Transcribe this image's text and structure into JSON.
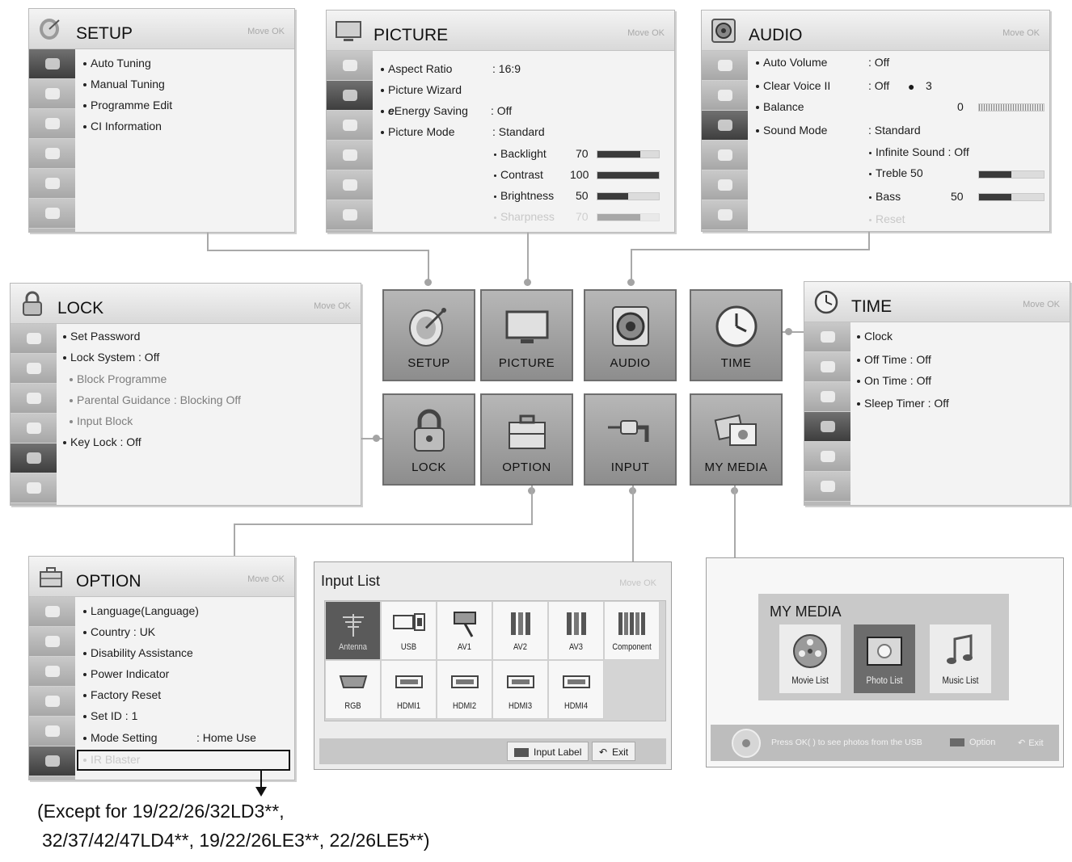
{
  "nav_hint": "Move  OK",
  "setup": {
    "title": "SETUP",
    "items": [
      "Auto Tuning",
      "Manual Tuning",
      "Programme Edit",
      "CI Information"
    ]
  },
  "picture": {
    "title": "PICTURE",
    "items": [
      {
        "label": "Aspect Ratio",
        "value": ": 16:9"
      },
      {
        "label": "Picture Wizard",
        "value": ""
      },
      {
        "label": "Energy Saving",
        "value": ": Off"
      },
      {
        "label": "Picture Mode",
        "value": ": Standard"
      }
    ],
    "sub": [
      {
        "label": "Backlight",
        "value": "70",
        "level": 70
      },
      {
        "label": "Contrast",
        "value": "100",
        "level": 100
      },
      {
        "label": "Brightness",
        "value": "50",
        "level": 50
      },
      {
        "label": "Sharpness",
        "value": "70",
        "level": 70
      }
    ]
  },
  "audio": {
    "title": "AUDIO",
    "items": [
      {
        "label": "Auto Volume",
        "value": ": Off"
      },
      {
        "label": "Clear Voice II",
        "value": ": Off",
        "extra": "3"
      },
      {
        "label": "Balance",
        "value": "0"
      },
      {
        "label": "Sound Mode",
        "value": ": Standard"
      }
    ],
    "sub": [
      {
        "label": "Infinite Sound : Off"
      },
      {
        "label": "Treble  50",
        "level": 50
      },
      {
        "label": "Bass",
        "value": "50",
        "level": 50
      },
      {
        "label": "Reset"
      }
    ]
  },
  "lock": {
    "title": "LOCK",
    "items": [
      {
        "label": "Set Password"
      },
      {
        "label": "Lock System   : Off"
      },
      {
        "label": "Block Programme"
      },
      {
        "label": "Parental Guidance : Blocking Off"
      },
      {
        "label": "Input Block"
      },
      {
        "label": "Key Lock   : Off"
      }
    ]
  },
  "time": {
    "title": "TIME",
    "items": [
      "Clock",
      "Off Time   : Off",
      "On Time   : Off",
      "Sleep Timer   : Off"
    ]
  },
  "option": {
    "title": "OPTION",
    "items": [
      {
        "label": "Language(Language)"
      },
      {
        "label": "Country   : UK"
      },
      {
        "label": "Disability Assistance"
      },
      {
        "label": "Power Indicator"
      },
      {
        "label": "Factory Reset"
      },
      {
        "label": "Set ID   : 1"
      },
      {
        "label": "Mode Setting",
        "value": ": Home Use"
      },
      {
        "label": "IR Blaster"
      }
    ]
  },
  "tiles": [
    "SETUP",
    "PICTURE",
    "AUDIO",
    "TIME",
    "LOCK",
    "OPTION",
    "INPUT",
    "MY MEDIA"
  ],
  "input_list": {
    "title": "Input List",
    "nav": "Move  OK",
    "sources": [
      "Antenna",
      "USB",
      "AV1",
      "AV2",
      "AV3",
      "Component",
      "RGB",
      "HDMI1",
      "HDMI2",
      "HDMI3",
      "HDMI4"
    ],
    "footer_buttons": [
      "Input Label",
      "Exit"
    ]
  },
  "my_media": {
    "title": "MY MEDIA",
    "items": [
      "Movie List",
      "Photo List",
      "Music List"
    ],
    "hint": "Press OK( ) to see photos from the USB",
    "option": "Option",
    "exit": "Exit"
  },
  "note": {
    "line1": "(Except for 19/22/26/32LD3**,",
    "line2": "32/37/42/47LD4**, 19/22/26LE3**, 22/26LE5**)"
  }
}
